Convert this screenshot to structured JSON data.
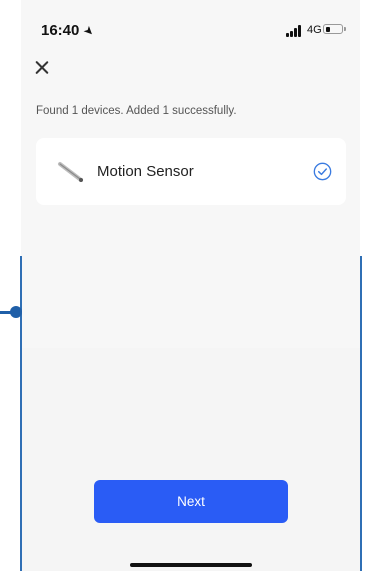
{
  "status_bar": {
    "time": "16:40",
    "network": "4G",
    "battery_level": 0.3
  },
  "header": {
    "close_icon": "close-icon"
  },
  "summary_text": "Found 1 devices. Added 1 successfully.",
  "devices": [
    {
      "name": "Motion Sensor",
      "icon": "motion-sensor-icon",
      "status_icon": "check-circle-icon"
    }
  ],
  "footer": {
    "next_label": "Next"
  },
  "colors": {
    "accent": "#2a5cf5",
    "check": "#3a7be0",
    "background": "#f7f7f7"
  }
}
